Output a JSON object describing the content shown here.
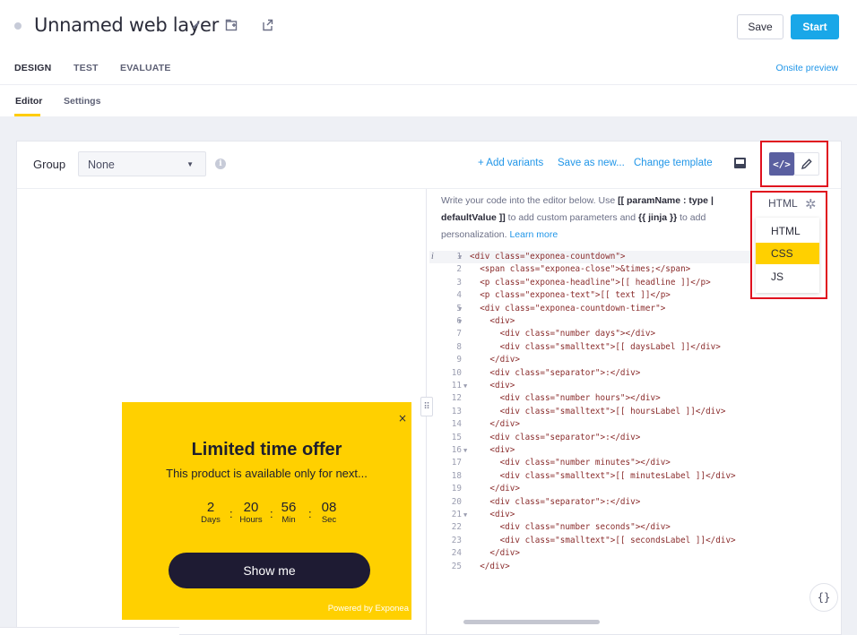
{
  "header": {
    "title": "Unnamed web layer",
    "save_label": "Save",
    "start_label": "Start"
  },
  "tabs": [
    "DESIGN",
    "TEST",
    "EVALUATE"
  ],
  "onsite_preview": "Onsite preview",
  "subtabs": [
    "Editor",
    "Settings"
  ],
  "toolbar": {
    "group_label": "Group",
    "group_value": "None",
    "add_variants": "+ Add variants",
    "save_as_new": "Save as new...",
    "change_template": "Change template"
  },
  "editor": {
    "hint_a": "Write your code into the editor below. Use ",
    "hint_b": "[[ paramName : type | defaultValue ]]",
    "hint_c": " to add custom parameters and ",
    "hint_d": "{{ jinja }}",
    "hint_e": " to add personalization. ",
    "hint_link": "Learn more",
    "language_current": "HTML",
    "language_options": [
      "HTML",
      "CSS",
      "JS"
    ],
    "language_selected": "CSS",
    "code_lines": [
      "<div class=\"exponea-countdown\">",
      "  <span class=\"exponea-close\">&times;</span>",
      "  <p class=\"exponea-headline\">[[ headline ]]</p>",
      "  <p class=\"exponea-text\">[[ text ]]</p>",
      "  <div class=\"exponea-countdown-timer\">",
      "    <div>",
      "      <div class=\"number days\"></div>",
      "      <div class=\"smalltext\">[[ daysLabel ]]</div>",
      "    </div>",
      "    <div class=\"separator\">:</div>",
      "    <div>",
      "      <div class=\"number hours\"></div>",
      "      <div class=\"smalltext\">[[ hoursLabel ]]</div>",
      "    </div>",
      "    <div class=\"separator\">:</div>",
      "    <div>",
      "      <div class=\"number minutes\"></div>",
      "      <div class=\"smalltext\">[[ minutesLabel ]]</div>",
      "    </div>",
      "    <div class=\"separator\">:</div>",
      "    <div>",
      "      <div class=\"number seconds\"></div>",
      "      <div class=\"smalltext\">[[ secondsLabel ]]</div>",
      "    </div>",
      "  </div>"
    ],
    "fold_lines": [
      1,
      5,
      6,
      11,
      16,
      21
    ]
  },
  "preview": {
    "close": "×",
    "headline": "Limited time offer",
    "text": "This product is available only for next...",
    "countdown": [
      {
        "num": "2",
        "label": "Days"
      },
      {
        "num": "20",
        "label": "Hours"
      },
      {
        "num": "56",
        "label": "Min"
      },
      {
        "num": "08",
        "label": "Sec"
      }
    ],
    "separator": ":",
    "button": "Show me",
    "powered": "Powered by Exponea"
  },
  "colors": {
    "accent_yellow": "#ffd000",
    "primary_blue": "#19a7e8",
    "link_blue": "#2196e8",
    "highlight_red": "#e0101e",
    "toggle_purple": "#5a5fa0"
  }
}
